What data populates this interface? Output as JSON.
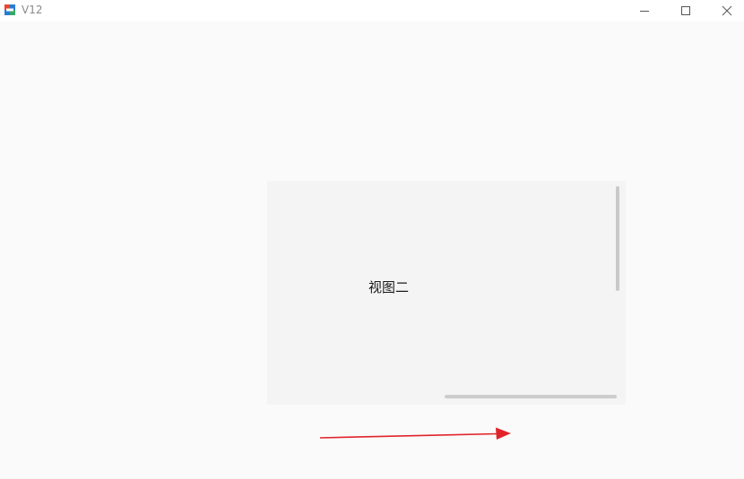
{
  "window": {
    "title": "V12",
    "app_icon": "app-logo-icon",
    "controls": {
      "minimize_icon": "minimize-icon",
      "maximize_icon": "maximize-icon",
      "close_icon": "close-icon"
    }
  },
  "view": {
    "label": "视图二"
  },
  "annotation": {
    "arrow_icon": "right-arrow-icon",
    "arrow_color": "#e0242a"
  },
  "colors": {
    "background": "#fafafa",
    "panel": "#f4f4f4",
    "scrollbar": "#c9c9c9"
  }
}
